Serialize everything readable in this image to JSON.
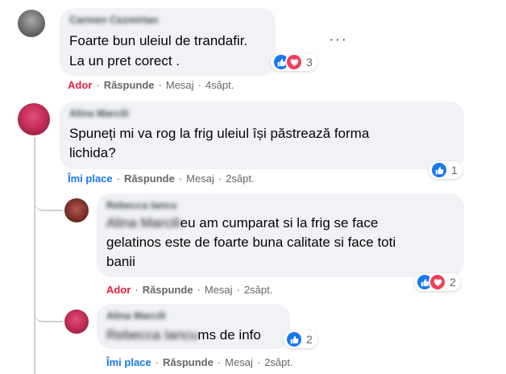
{
  "comments": [
    {
      "author": "Carmen Cezmirtan",
      "lines": [
        "Foarte bun uleiul de trandafir.",
        "La un pret corect ."
      ],
      "actions": {
        "react": "Ador",
        "reply": "Răspunde",
        "message": "Mesaj",
        "time": "4săpt."
      },
      "reactions": {
        "count": "3"
      }
    },
    {
      "author": "Alina Marcili",
      "lines": [
        "Spuneți mi va rog la frig uleiul își păstrează forma",
        "lichida?"
      ],
      "actions": {
        "react": "Îmi place",
        "reply": "Răspunde",
        "message": "Mesaj",
        "time": "2săpt."
      },
      "reactions": {
        "count": "1"
      }
    }
  ],
  "replies": [
    {
      "author": "Rebecca Iancu",
      "tag": "Alina Marcili",
      "first_line_rest": "eu am cumparat si la frig se face",
      "lines": [
        "gelatinos este de foarte buna calitate si face toti",
        "banii"
      ],
      "actions": {
        "react": "Ador",
        "reply": "Răspunde",
        "message": "Mesaj",
        "time": "2săpt."
      },
      "reactions": {
        "count": "2"
      }
    },
    {
      "author": "Alina Marcili",
      "tag": "Rebecca Iancu",
      "first_line_rest": "ms de info",
      "actions": {
        "react": "Îmi place",
        "reply": "Răspunde",
        "message": "Mesaj",
        "time": "2săpt."
      },
      "reactions": {
        "count": "2"
      }
    }
  ],
  "ui": {
    "more_options": "···",
    "separator": "·"
  },
  "colors": {
    "bubble": "#f0f2f5",
    "like": "#1877f2",
    "love": "#f33e58",
    "love_action": "#e41e3f",
    "meta": "#65676b"
  },
  "icons": [
    "like-icon",
    "love-icon",
    "more-options-icon"
  ]
}
